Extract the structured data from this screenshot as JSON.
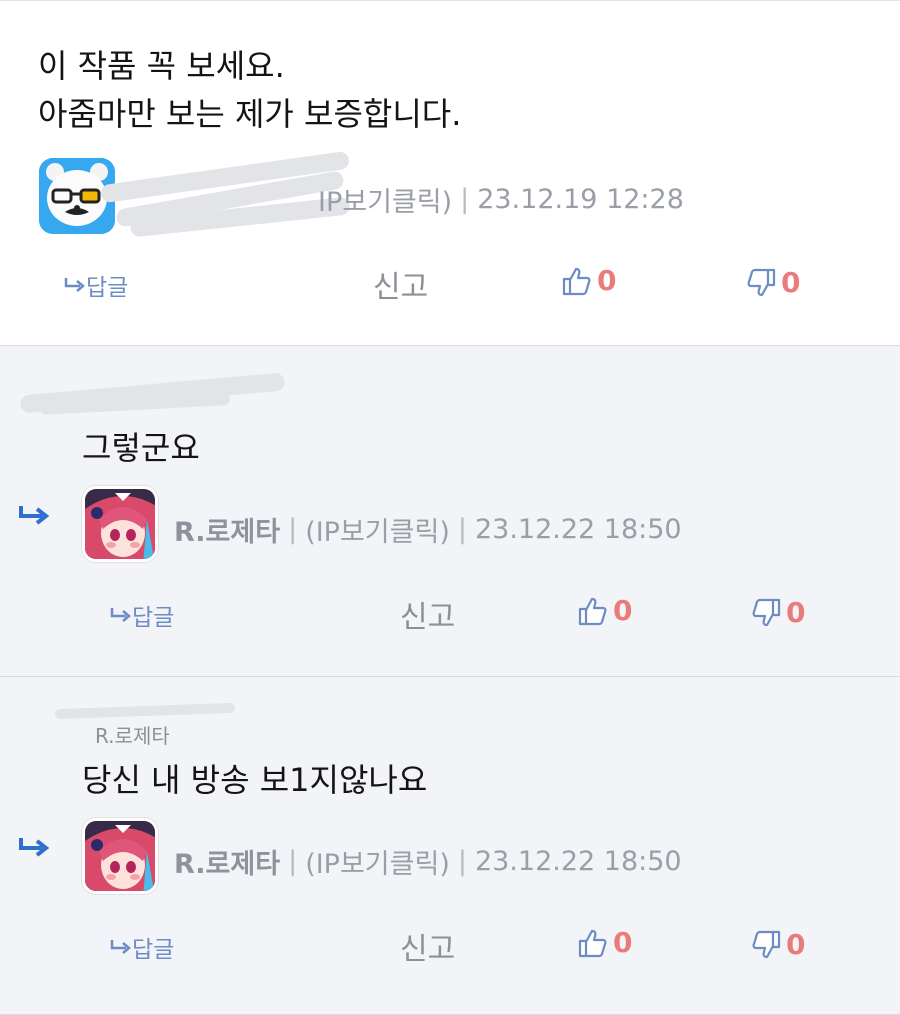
{
  "comments": [
    {
      "text_lines": [
        "이 작품 꼭 보세요.",
        "아줌마만 보는 제가 보증합니다."
      ],
      "ip_text": "IP보기클릭)",
      "date": "23.12.19 12:28",
      "reply_label": "답글",
      "report_label": "신고",
      "likes": "0",
      "dislikes": "0"
    },
    {
      "text": "그렇군요",
      "nickname": "R.로제타",
      "ip_text": "(IP보기클릭)",
      "date": "23.12.22 18:50",
      "reply_label": "답글",
      "report_label": "신고",
      "likes": "0",
      "dislikes": "0"
    },
    {
      "reply_to": "R.로제타",
      "text": "당신 내 방송 보1지않나요",
      "nickname": "R.로제타",
      "ip_text": "(IP보기클릭)",
      "date": "23.12.22 18:50",
      "reply_label": "답글",
      "report_label": "신고",
      "likes": "0",
      "dislikes": "0"
    }
  ],
  "colors": {
    "reply_blue": "#6c8cc5",
    "arrow_blue": "#2f6fd0",
    "count_red": "#ea7b7b",
    "reply_bg": "#f3f4f7"
  },
  "icons": [
    "reply-arrow-icon",
    "thumbs-up-icon",
    "thumbs-down-icon",
    "avatar-bear",
    "avatar-rosetta"
  ]
}
